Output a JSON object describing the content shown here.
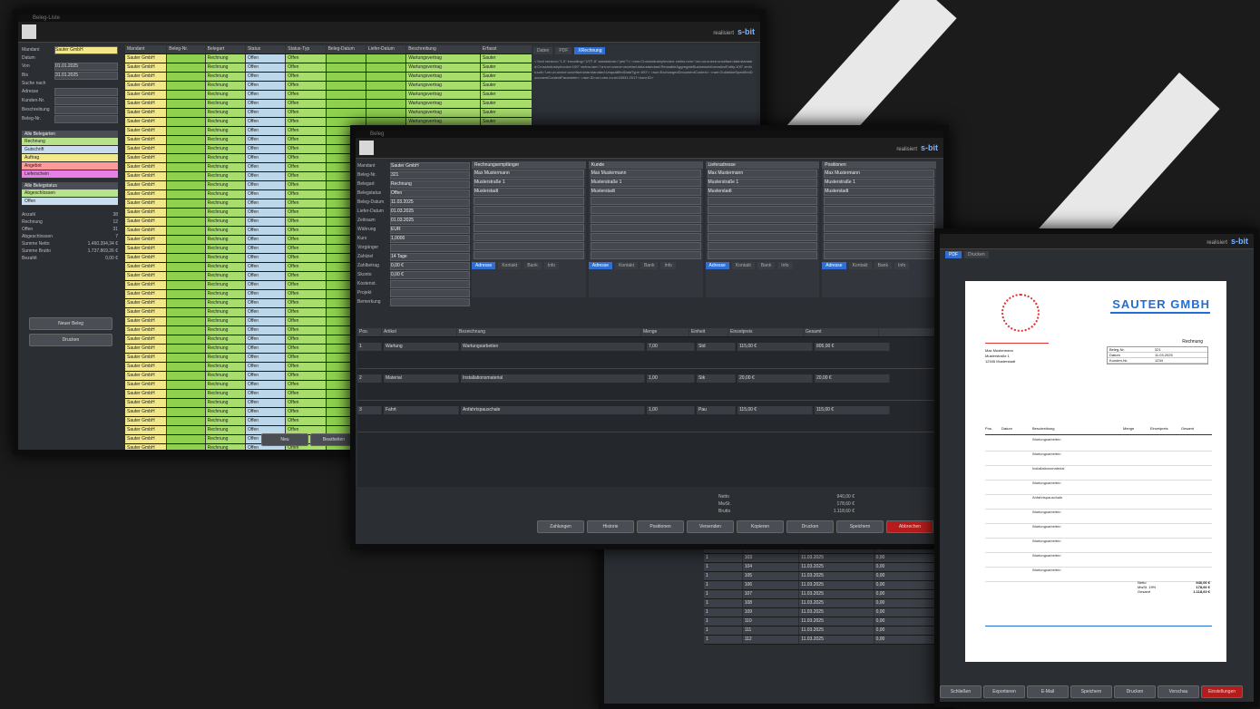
{
  "branding": {
    "label": "realisiert",
    "name": "s-bit"
  },
  "win1": {
    "title": "Beleg-Liste",
    "filter": {
      "mandant_label": "Mandant",
      "mandant_value": "Sauter GmbH",
      "datum_label": "Datum",
      "von_label": "Von",
      "von_value": "01.01.2025",
      "bis_label": "Bis",
      "bis_value": "31.01.2025",
      "suche_label": "Suche nach",
      "fields": [
        "Adresse",
        "Kunden-Nr.",
        "Beschreibung",
        "Beleg-Nr."
      ]
    },
    "status_groups": {
      "title1": "Alle Belegarten",
      "items1": [
        "Rechnung",
        "Gutschrift",
        "Auftrag",
        "Angebot",
        "Lieferschein"
      ],
      "title2": "Alle Belegstatus",
      "items2": [
        "Abgeschlossen",
        "Offen"
      ]
    },
    "stats": [
      [
        "Anzahl",
        "38"
      ],
      [
        "Rechnung",
        "12"
      ],
      [
        "Offen",
        "31"
      ],
      [
        "Abgeschlossen",
        "7"
      ],
      [
        "Summe Netto",
        "1.460.394,34 €"
      ],
      [
        "Summe Brutto",
        "1.737.869,26 €"
      ],
      [
        "Bezahlt",
        "0,00 €"
      ]
    ],
    "buttons": [
      "Neuer Beleg",
      "Drucken"
    ],
    "table_headers": [
      "Mandant",
      "Beleg-Nr.",
      "Belegart",
      "Status",
      "Status-Typ",
      "Beleg-Datum",
      "Liefer-Datum",
      "Beschreibung",
      "Erfasst"
    ],
    "row_mandant": "Sauter GmbH",
    "row_type": "Rechnung",
    "row_status": "Offen",
    "row_desc": "Wartungsvertrag",
    "row_user": "Sauter",
    "tabs": [
      "Daten",
      "PDF",
      "XRechnung"
    ],
    "xml_text": "<?xml version=\"1.0\" encoding=\"UTF-8\" standalone=\"yes\"?> <rsm:CrossIndustryInvoice xmlns:rsm=\"urn:un:unece:uncefact:data:standard:CrossIndustryInvoice:100\" xmlns:ram=\"urn:un:unece:uncefact:data:standard:ReusableAggregateBusinessInformationEntity:100\" xmlns:udt=\"urn:un:unece:uncefact:data:standard:UnqualifiedDataType:100\"> <rsm:ExchangedDocumentContext> <ram:GuidelineSpecifiedDocumentContextParameter> <ram:ID>urn:cen.eu:en16931:2017</ram:ID>",
    "footer_buttons": [
      "Neu",
      "Bearbeiten"
    ]
  },
  "win2": {
    "title": "Beleg",
    "left_fields": [
      [
        "Mandant",
        "Sauter GmbH"
      ],
      [
        "Beleg-Nr.",
        "321"
      ],
      [
        "Belegart",
        "Rechnung"
      ],
      [
        "Belegstatus",
        "Offen"
      ],
      [
        "Beleg-Datum",
        "11.03.2025"
      ],
      [
        "Liefer-Datum",
        "01.03.2025"
      ],
      [
        "Zeitraum",
        "01.03.2025"
      ],
      [
        "Währung",
        "EUR"
      ],
      [
        "Kurs",
        "1,0000"
      ],
      [
        "Vorgänger",
        ""
      ],
      [
        "Zahlziel",
        "14 Tage"
      ],
      [
        "Zahlbetrag",
        "0,00 €"
      ],
      [
        "Skonto",
        "0,00 €"
      ],
      [
        "Kostenst.",
        ""
      ],
      [
        "Projekt",
        ""
      ],
      [
        "Bemerkung",
        ""
      ]
    ],
    "sections": [
      "Rechnungsempfänger",
      "Kunde",
      "Lieferadresse",
      "Positionen"
    ],
    "section_tabs": [
      "Adresse",
      "Kontakt",
      "Bank",
      "Info"
    ],
    "firma": "Max Mustermann",
    "strasse": "Musterstraße 1",
    "ort": "Musterstadt",
    "positions_header": [
      "Pos.",
      "Artikel",
      "Bezeichnung",
      "Menge",
      "Einheit",
      "Einzelpreis",
      "Gesamt"
    ],
    "positions": [
      {
        "pos": "1",
        "article": "Wartung",
        "desc": "Wartungsarbeiten",
        "qty": "7,00",
        "unit": "Std",
        "price": "115,00 €",
        "total": "805,00 €"
      },
      {
        "pos": "2",
        "article": "Material",
        "desc": "Installationsmaterial",
        "qty": "1,00",
        "unit": "Stk",
        "price": "20,00 €",
        "total": "20,00 €"
      },
      {
        "pos": "3",
        "article": "Fahrt",
        "desc": "Anfahrtspauschale",
        "qty": "1,00",
        "unit": "Pau",
        "price": "115,00 €",
        "total": "115,00 €"
      }
    ],
    "totals": [
      [
        "Netto",
        "940,00 €"
      ],
      [
        "MwSt.",
        "178,60 €"
      ],
      [
        "Brutto",
        "1.118,60 €"
      ]
    ],
    "footer_buttons": [
      "Zahlungen",
      "Historie",
      "Positionen",
      "Versenden",
      "Kopieren",
      "Drucken",
      "Speichern",
      "Abbrechen"
    ]
  },
  "win3": {
    "tabs": [
      "PDF",
      "Drucken"
    ],
    "company": "SAUTER GMBH",
    "logo_text": "s-bit",
    "recipient": [
      "Max Mustermann",
      "Musterstraße 1",
      "12345 Musterstadt"
    ],
    "doc_title": "Rechnung",
    "info": [
      [
        "Beleg-Nr.",
        "321"
      ],
      [
        "Datum",
        "11.03.2025"
      ],
      [
        "Kunden-Nr.",
        "1234"
      ]
    ],
    "item_headers": [
      "Pos.",
      "Datum",
      "Beschreibung",
      "Menge",
      "Einzelpreis",
      "Gesamt"
    ],
    "items": [
      "Wartungsarbeiten",
      "Wartungsarbeiten",
      "Installationsmaterial",
      "Wartungsarbeiten",
      "Anfahrtspauschale",
      "Wartungsarbeiten",
      "Wartungsarbeiten",
      "Wartungsarbeiten",
      "Wartungsarbeiten",
      "Wartungsarbeiten"
    ],
    "totals": [
      [
        "Netto",
        "940,00 €"
      ],
      [
        "MwSt. 19%",
        "178,60 €"
      ],
      [
        "Gesamt",
        "1.118,60 €"
      ]
    ],
    "footer_buttons": [
      "Schließen",
      "Exportieren",
      "E-Mail",
      "Speichern",
      "Drucken",
      "Vorschau",
      "Einstellungen"
    ]
  },
  "win4": {
    "rows": [
      [
        "1",
        "101",
        "11.03.2025",
        "0,00"
      ],
      [
        "1",
        "102",
        "11.03.2025",
        "0,00"
      ],
      [
        "1",
        "103",
        "11.03.2025",
        "0,00"
      ],
      [
        "1",
        "104",
        "11.03.2025",
        "0,00"
      ],
      [
        "1",
        "105",
        "11.03.2025",
        "0,00"
      ],
      [
        "1",
        "106",
        "11.03.2025",
        "0,00"
      ],
      [
        "1",
        "107",
        "11.03.2025",
        "0,00"
      ],
      [
        "1",
        "108",
        "11.03.2025",
        "0,00"
      ],
      [
        "1",
        "109",
        "11.03.2025",
        "0,00"
      ],
      [
        "1",
        "110",
        "11.03.2025",
        "0,00"
      ],
      [
        "1",
        "111",
        "11.03.2025",
        "0,00"
      ],
      [
        "1",
        "112",
        "11.03.2025",
        "0,00"
      ]
    ]
  }
}
